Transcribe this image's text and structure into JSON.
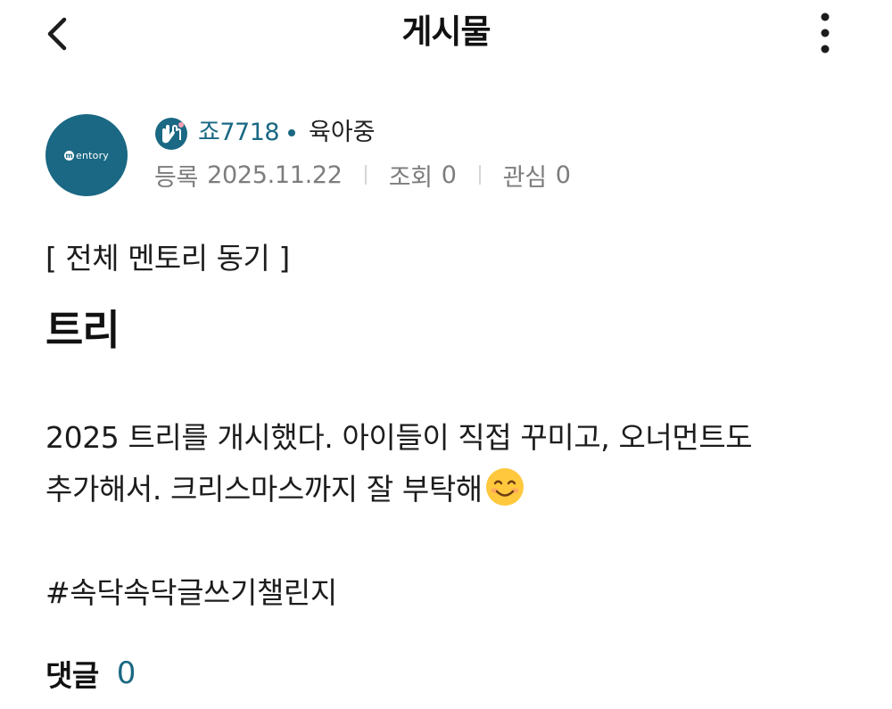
{
  "header": {
    "title": "게시물",
    "back_icon": "chevron-left-icon",
    "more_icon": "more-vertical-icon"
  },
  "author": {
    "avatar_logo": "entory",
    "nickname": "죠7718",
    "status": "육아중",
    "badge_icon": "hands-badge-icon"
  },
  "meta": {
    "registered_label": "등록",
    "registered_date": "2025.11.22",
    "views_label": "조회",
    "views": "0",
    "interest_label": "관심",
    "interest": "0"
  },
  "post": {
    "category": "[ 전체 멘토리 동기 ]",
    "title": "트리",
    "body_line1": "2025 트리를 개시했다. 아이들이 직접 꾸미고, 오너먼트도",
    "body_line2": "추가해서. 크리스마스까지 잘 부탁해",
    "emoji": "smiling-face-emoji",
    "hashtag": "#속닥속닥글쓰기챌린지"
  },
  "comments": {
    "label": "댓글",
    "count": "0"
  },
  "colors": {
    "accent": "#1a6883",
    "text": "#1c1c1c",
    "meta_text": "#7d7d7d",
    "divider": "#d6d6d6"
  }
}
